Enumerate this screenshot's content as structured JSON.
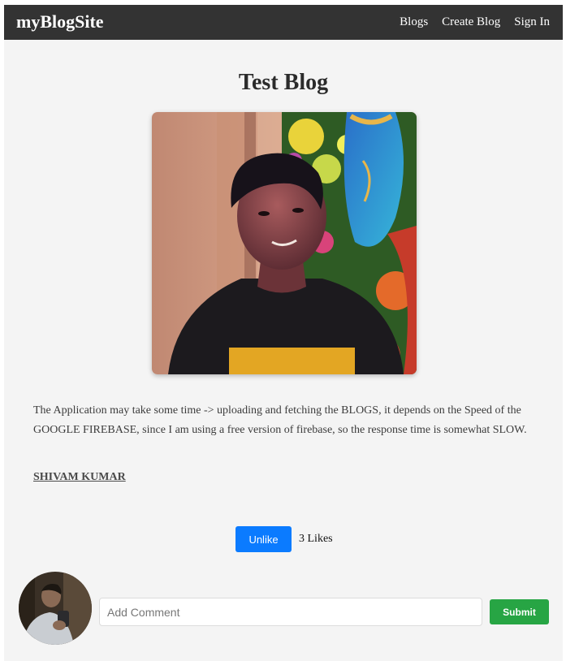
{
  "navbar": {
    "brand": "myBlogSite",
    "links": [
      {
        "label": "Blogs"
      },
      {
        "label": "Create Blog"
      },
      {
        "label": "Sign In"
      }
    ]
  },
  "blog": {
    "title": "Test Blog",
    "content": "The Application may take some time -> uploading and fetching the BLOGS, it depends on the Speed of the GOOGLE FIREBASE, since I am using a free version of firebase, so the response time is somewhat SLOW.",
    "author": "SHIVAM KUMAR"
  },
  "likes": {
    "button_label": "Unlike",
    "count_text": "3 Likes"
  },
  "comment": {
    "placeholder": "Add Comment",
    "value": "",
    "submit_label": "Submit"
  },
  "colors": {
    "navbar_bg": "#333333",
    "page_bg": "#f4f4f4",
    "like_button": "#0b7bff",
    "submit_button": "#27a544"
  }
}
